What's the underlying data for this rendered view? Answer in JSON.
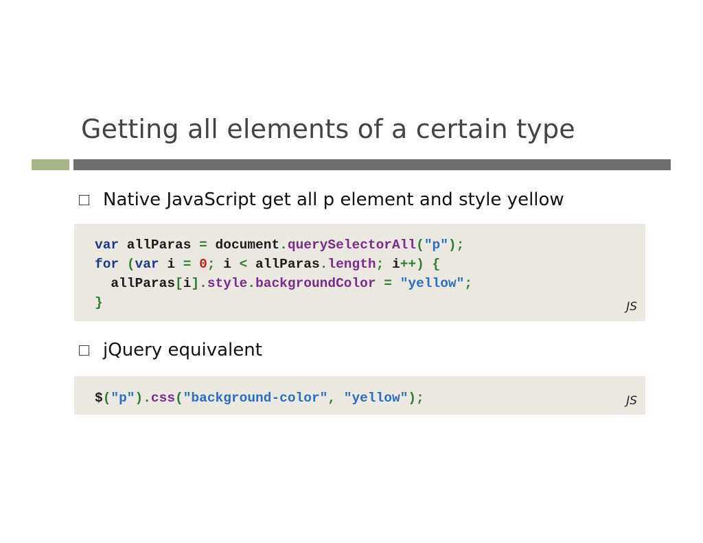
{
  "slide": {
    "title": "Getting all elements of a certain type"
  },
  "bullets": [
    {
      "text": "Native JavaScript get all p element and style yellow"
    },
    {
      "text": "jQuery equivalent"
    }
  ],
  "code_blocks": [
    {
      "language": "JS",
      "lines": [
        "var allParas = document.querySelectorAll(\"p\");",
        "for (var i = 0; i < allParas.length; i++) {",
        "  allParas[i].style.backgroundColor = \"yellow\";",
        "}"
      ]
    },
    {
      "language": "JS",
      "lines": [
        "$(\"p\").css(\"background-color\", \"yellow\");"
      ]
    }
  ],
  "colors": {
    "title": "#444444",
    "accent_bar": "#a7b389",
    "main_bar": "#707072",
    "code_background": "#ebe8e1"
  }
}
